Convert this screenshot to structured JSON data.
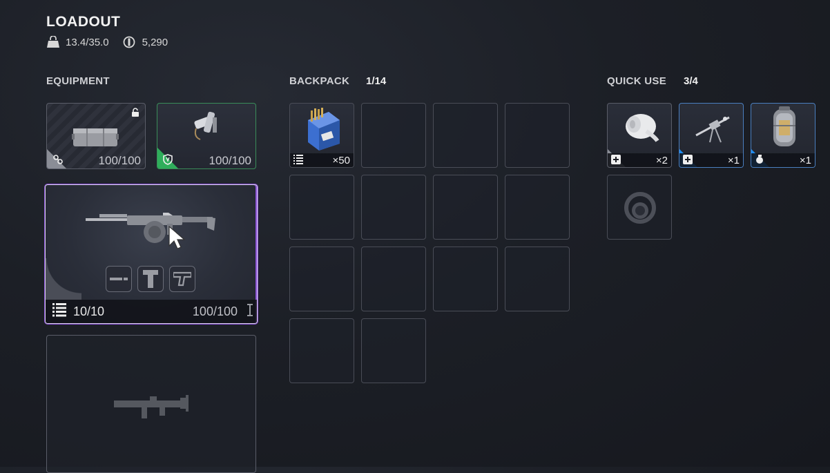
{
  "header": {
    "title": "LOADOUT",
    "weight": "13.4/35.0",
    "currency": "5,290"
  },
  "equipment": {
    "label": "EQUIPMENT",
    "backpack_slot": {
      "durability": "100/100",
      "icon": "backpack-crate-icon",
      "lock_icon": "unlock-icon",
      "accent": "#8a8d96"
    },
    "shield_slot": {
      "durability": "100/100",
      "icon": "shield-gadget-icon",
      "accent": "#2fae5b"
    },
    "primary_weapon": {
      "ammo": "10/10",
      "durability": "100/100",
      "icon": "machine-gun-icon",
      "accent": "#8a4fd8",
      "attachments": [
        "muzzle-attachment-icon",
        "underbarrel-attachment-icon",
        "stock-attachment-icon"
      ]
    },
    "secondary_weapon": {
      "icon": "smg-silhouette-icon"
    }
  },
  "backpack": {
    "label": "BACKPACK",
    "count": "1/14",
    "items": [
      {
        "icon": "ammo-box-icon",
        "type_icon": "ammo-icon",
        "qty": "×50"
      },
      {},
      {},
      {},
      {},
      {},
      {},
      {},
      {},
      {},
      {},
      {},
      {},
      {}
    ]
  },
  "quick_use": {
    "label": "QUICK USE",
    "count": "3/4",
    "items": [
      {
        "icon": "bandage-icon",
        "type_icon": "heal-plus-icon",
        "qty": "×2",
        "accent": "#8a8d96"
      },
      {
        "icon": "zipline-gadget-icon",
        "type_icon": "heal-plus-icon",
        "qty": "×1",
        "accent": "#1e8cf0"
      },
      {
        "icon": "canister-icon",
        "type_icon": "grenade-icon",
        "qty": "×1",
        "accent": "#1e8cf0"
      },
      {
        "icon": "empty-slot-ring-icon"
      }
    ]
  }
}
